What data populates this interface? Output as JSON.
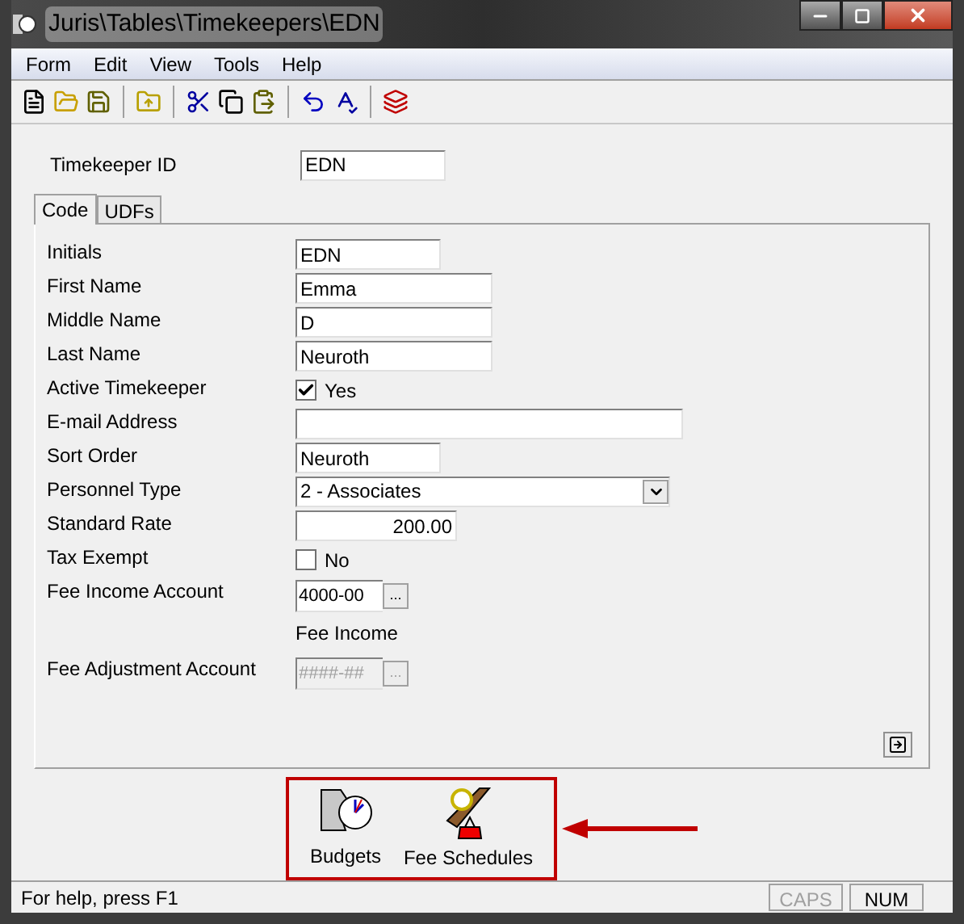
{
  "window": {
    "title": "Juris\\Tables\\Timekeepers\\EDN"
  },
  "menu": [
    "Form",
    "Edit",
    "View",
    "Tools",
    "Help"
  ],
  "header": {
    "label": "Timekeeper ID",
    "value": "EDN"
  },
  "tabs": [
    {
      "label": "Code",
      "selected": true
    },
    {
      "label": "UDFs",
      "selected": false
    }
  ],
  "fields": [
    {
      "kind": "text",
      "label": "Initials",
      "value": "EDN"
    },
    {
      "kind": "text",
      "label": "First Name",
      "value": "Emma"
    },
    {
      "kind": "text",
      "label": "Middle Name",
      "value": "D"
    },
    {
      "kind": "text",
      "label": "Last Name",
      "value": "Neuroth"
    },
    {
      "kind": "checkbox",
      "label": "Active Timekeeper",
      "text": "Yes",
      "checked": true
    },
    {
      "kind": "text",
      "label": "E-mail Address"
    },
    {
      "kind": "text",
      "label": "Sort Order",
      "value": "Neuroth"
    },
    {
      "kind": "select",
      "label": "Personnel Type",
      "value": "2 - Associates"
    },
    {
      "kind": "number",
      "label": "Standard Rate",
      "value": "200.00"
    },
    {
      "kind": "checkbox",
      "label": "Tax Exempt",
      "text": "No",
      "checked": false
    },
    {
      "kind": "account",
      "label": "Fee Income Account",
      "value": "4000-00",
      "button": "...",
      "disabled": false
    },
    {
      "kind": "note",
      "text": "Fee Income"
    },
    {
      "kind": "account",
      "label": "Fee Adjustment Account",
      "placeholder": "####-##",
      "button": "...",
      "disabled": true
    }
  ],
  "actions": [
    {
      "kind": "budgets",
      "label": "Budgets"
    },
    {
      "kind": "fees",
      "label": "Fee Schedules"
    }
  ],
  "status_bar": {
    "text": "For help, press F1",
    "indicators": [
      {
        "label": "CAPS",
        "disabled": true
      },
      {
        "label": "NUM",
        "disabled": false
      }
    ]
  }
}
